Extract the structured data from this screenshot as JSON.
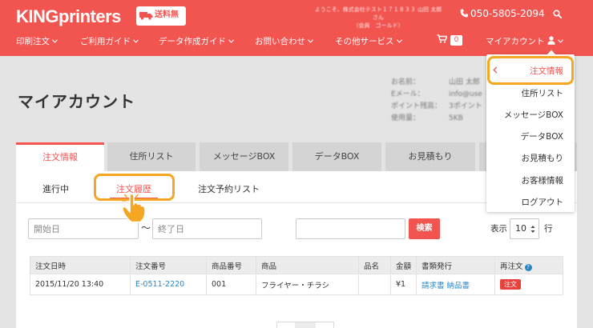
{
  "header": {
    "logo": "KINGprinters",
    "shipping_badge": "送料無料",
    "welcome_line1": "ようこそ、株式会社テスト１７１８３３ 山田 太郎さん",
    "welcome_line2": "（会員　ゴールド）",
    "phone": "050-5805-2094",
    "nav": [
      {
        "label": "印刷注文"
      },
      {
        "label": "ご利用ガイド"
      },
      {
        "label": "データ作成ガイド"
      },
      {
        "label": "お問い合わせ"
      },
      {
        "label": "その他サービス"
      }
    ],
    "cart_count": "0",
    "account_label": "マイアカウント"
  },
  "account": {
    "title": "マイアカウント",
    "info": [
      {
        "key": "お名前：",
        "value": "山田 太郎"
      },
      {
        "key": "Eメール：",
        "value": "info@use"
      },
      {
        "key": "ポイント残高：",
        "value": "3ポイント"
      },
      {
        "key": "使用量：",
        "value": "5KB"
      }
    ]
  },
  "tabs": [
    {
      "label": "注文情報",
      "active": true
    },
    {
      "label": "住所リスト"
    },
    {
      "label": "メッセージBOX"
    },
    {
      "label": "データBOX"
    },
    {
      "label": "お見積もり"
    }
  ],
  "subtabs": [
    {
      "label": "進行中"
    },
    {
      "label": "注文履歴",
      "active": true
    },
    {
      "label": "注文予約リスト"
    }
  ],
  "filters": {
    "start_placeholder": "開始日",
    "end_placeholder": "終了日",
    "tilde": "〜",
    "search_value": "",
    "search_button": "検索",
    "per_page_prefix": "表示",
    "per_page_value": "10",
    "per_page_suffix": "行"
  },
  "table": {
    "headers": [
      "注文日時",
      "注文番号",
      "商品番号",
      "商品",
      "品名",
      "金額",
      "書類発行",
      "再注文"
    ],
    "rows": [
      {
        "date": "2015/11/20 13:40",
        "order_no": "E-0511-2220",
        "product_no": "001",
        "product": "フライヤー・チラシ",
        "item_name": "",
        "amount": "¥1",
        "doc_invoice": "請求書",
        "doc_receipt": "納品書",
        "reorder": "注文"
      }
    ]
  },
  "dropdown": {
    "items": [
      {
        "label": "注文情報",
        "active": true
      },
      {
        "label": "住所リスト"
      },
      {
        "label": "メッセージBOX"
      },
      {
        "label": "データBOX"
      },
      {
        "label": "お見積もり"
      },
      {
        "label": "お客様情報"
      },
      {
        "label": "ログアウト"
      }
    ]
  },
  "colors": {
    "brand": "#f25450",
    "highlight": "#f5a623",
    "link": "#2a86c6"
  },
  "icons": [
    "truck-icon",
    "phone-icon",
    "search-icon",
    "chevron-down-icon",
    "cart-icon",
    "user-icon",
    "chevron-left-icon",
    "help-icon",
    "pointer-hand-icon",
    "spinner-icon"
  ]
}
